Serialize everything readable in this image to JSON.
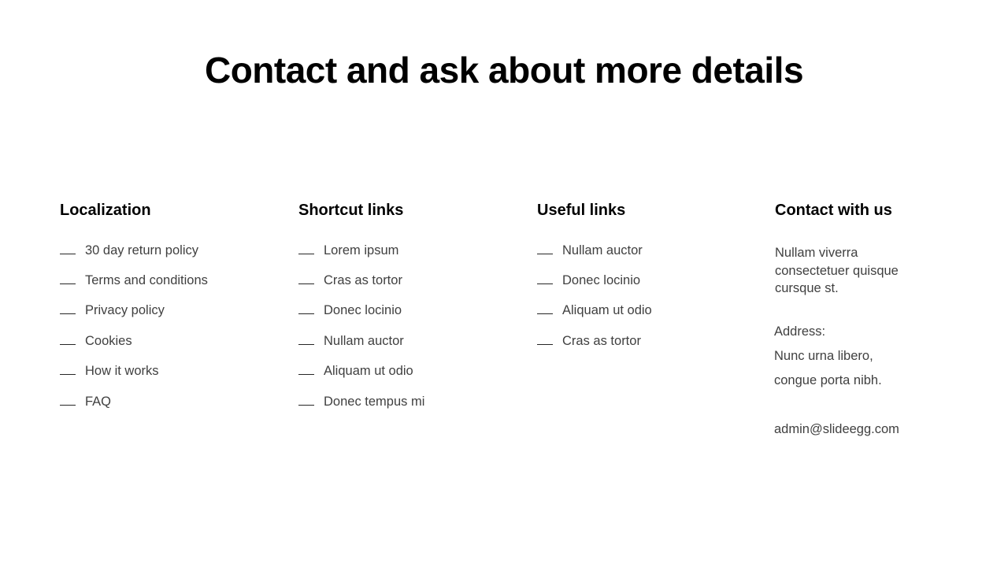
{
  "title": "Contact and ask about more details",
  "columns": [
    {
      "heading": "Localization",
      "items": [
        "30 day return policy",
        "Terms and conditions",
        "Privacy policy",
        "Cookies",
        "How it works",
        "FAQ"
      ]
    },
    {
      "heading": "Shortcut links",
      "items": [
        "Lorem ipsum",
        "Cras as tortor",
        "Donec locinio",
        "Nullam auctor",
        "Aliquam ut odio",
        "Donec tempus mi"
      ]
    },
    {
      "heading": "Useful links",
      "items": [
        "Nullam auctor",
        "Donec locinio",
        "Aliquam ut odio",
        "Cras as tortor"
      ]
    }
  ],
  "contact": {
    "heading": "Contact with us",
    "intro": "Nullam viverra consectetuer quisque cursque st.",
    "address_label": "Address:",
    "address_line1": "Nunc urna libero,",
    "address_line2": "congue porta nibh.",
    "email": "admin@slideegg.com"
  },
  "colors": {
    "title": "#000000",
    "heading": "#000000",
    "body_text": "#404040",
    "dash": "#262626",
    "background": "#ffffff"
  }
}
